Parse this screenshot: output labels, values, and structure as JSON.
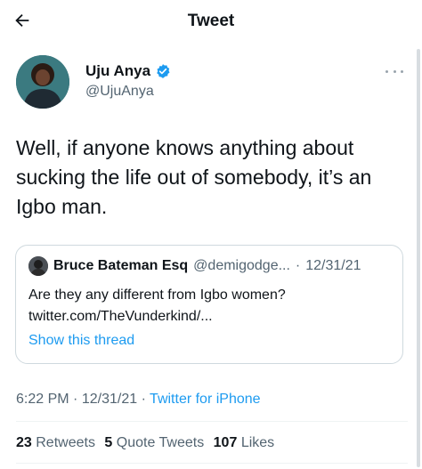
{
  "header": {
    "title": "Tweet",
    "back_icon": "arrow-left-icon"
  },
  "author": {
    "display_name": "Uju Anya",
    "handle": "@UjuAnya",
    "verified_icon": "verified-badge-icon",
    "more_icon": "more-horizontal-icon"
  },
  "tweet": {
    "text": "Well, if anyone knows anything about sucking the life out of somebody, it’s an Igbo man."
  },
  "quoted_tweet": {
    "display_name": "Bruce Bateman Esq",
    "handle": "@demigodge...",
    "separator": "·",
    "date": "12/31/21",
    "text_line1": "Are they any different from Igbo women?",
    "text_line2": "twitter.com/TheVunderkind/...",
    "show_thread": "Show this thread"
  },
  "meta": {
    "time": "6:22 PM",
    "separator": "·",
    "date": "12/31/21",
    "source": "Twitter for iPhone"
  },
  "stats": {
    "retweets_count": "23",
    "retweets_label": "Retweets",
    "quotes_count": "5",
    "quotes_label": "Quote Tweets",
    "likes_count": "107",
    "likes_label": "Likes"
  },
  "colors": {
    "accent": "#1d9bf0",
    "text": "#0f1419",
    "secondary": "#536471"
  }
}
